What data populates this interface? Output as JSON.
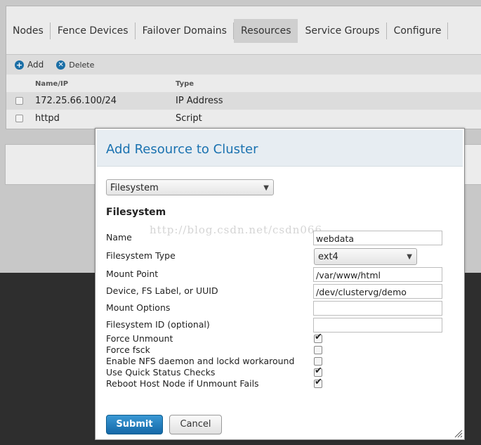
{
  "tabs": [
    {
      "label": "Nodes"
    },
    {
      "label": "Fence Devices"
    },
    {
      "label": "Failover Domains"
    },
    {
      "label": "Resources",
      "active": true
    },
    {
      "label": "Service Groups"
    },
    {
      "label": "Configure"
    }
  ],
  "toolbar": {
    "add_label": "Add",
    "delete_label": "Delete",
    "add_icon": "plus-circle-icon",
    "delete_icon": "x-circle-icon"
  },
  "table": {
    "headers": {
      "name": "Name/IP",
      "type": "Type"
    },
    "rows": [
      {
        "name": "172.25.66.100/24",
        "type": "IP Address"
      },
      {
        "name": "httpd",
        "type": "Script"
      }
    ]
  },
  "dialog": {
    "title": "Add Resource to Cluster",
    "resource_type": "Filesystem",
    "section_title": "Filesystem",
    "fields": {
      "name": {
        "label": "Name",
        "value": "webdata"
      },
      "fs_type": {
        "label": "Filesystem Type",
        "value": "ext4"
      },
      "mount_point": {
        "label": "Mount Point",
        "value": "/var/www/html"
      },
      "device": {
        "label": "Device, FS Label, or UUID",
        "value": "/dev/clustervg/demo"
      },
      "mount_options": {
        "label": "Mount Options",
        "value": ""
      },
      "fs_id": {
        "label": "Filesystem ID (optional)",
        "value": ""
      }
    },
    "checkboxes": {
      "force_unmount": {
        "label": "Force Unmount",
        "checked": true
      },
      "force_fsck": {
        "label": "Force fsck",
        "checked": false
      },
      "nfs_workaround": {
        "label": "Enable NFS daemon and lockd workaround",
        "checked": false
      },
      "quick_status": {
        "label": "Use Quick Status Checks",
        "checked": true
      },
      "reboot_host": {
        "label": "Reboot Host Node if Unmount Fails",
        "checked": true
      }
    },
    "submit_label": "Submit",
    "cancel_label": "Cancel",
    "watermark": "http://blog.csdn.net/csdn066"
  },
  "colors": {
    "accent": "#1a72b0",
    "submit": "#1a6ea6",
    "dark_background": "#2e2e2e"
  }
}
